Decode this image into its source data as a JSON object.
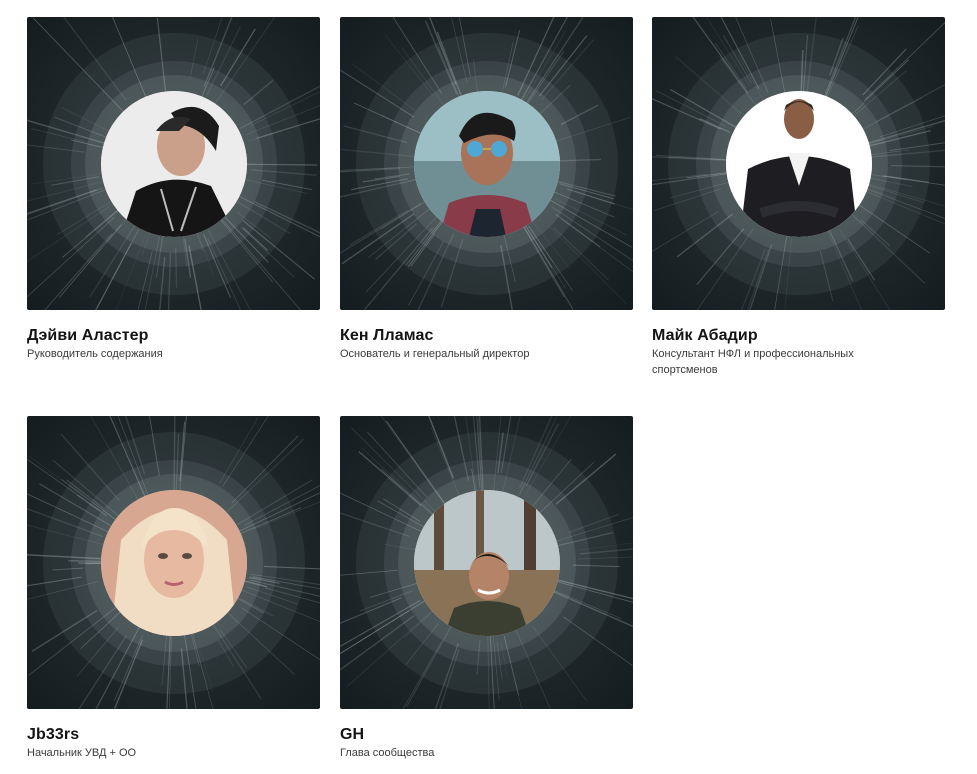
{
  "team": {
    "members": [
      {
        "name": "Дэйви Аластер",
        "role": "Руководитель содержания",
        "avatar_icon": "person-beanie-photo",
        "avatar_bg": "#e9e9e9"
      },
      {
        "name": "Кен Лламас",
        "role": "Основатель и генеральный директор",
        "avatar_icon": "person-sunglasses-photo",
        "avatar_bg": "#8fb3bb"
      },
      {
        "name": "Майк Абадир",
        "role": "Консультант НФЛ и профессиональных спортсменов",
        "avatar_icon": "person-suit-photo",
        "avatar_bg": "#ffffff"
      },
      {
        "name": "Jb33rs",
        "role": "Начальник УВД + ОО",
        "avatar_icon": "person-blonde-photo",
        "avatar_bg": "#e8b7a0"
      },
      {
        "name": "GH",
        "role": "Глава сообщества",
        "avatar_icon": "person-forest-photo",
        "avatar_bg": "#7a6a55"
      }
    ]
  },
  "colors": {
    "card_background": "#1e2629",
    "ring": "#96a5aa",
    "name_text": "#141414",
    "role_text": "#3a3a3a"
  }
}
